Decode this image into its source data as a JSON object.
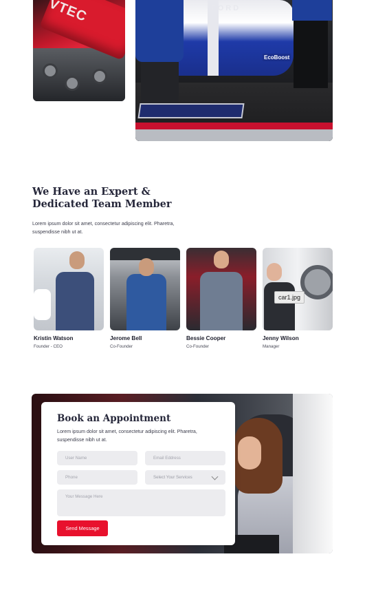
{
  "gallery": {
    "engine_text": "VTEC",
    "car_brand_text": "FORD",
    "car_sponsor_text": "EcoBoost"
  },
  "team": {
    "title": "We Have an Expert & Dedicated Team Member",
    "description": "Lorem ipsum dolor sit amet, consectetur adipiscing elit. Pharetra, suspendisse nibh ut at.",
    "members": [
      {
        "name": "Kristin Watson",
        "role": "Founder - CEO"
      },
      {
        "name": "Jerome Bell",
        "role": "Co-Founder"
      },
      {
        "name": "Bessie Cooper",
        "role": "Co-Founder"
      },
      {
        "name": "Jenny Wilson",
        "role": "Manager"
      }
    ],
    "tooltip": "car1.jpg"
  },
  "appointment": {
    "title": "Book an Appointment",
    "description": "Lorem ipsum dolor sit amet, consectetur adipiscing elit. Pharetra, suspendisse nibh ut at.",
    "fields": {
      "user_name_placeholder": "User Name",
      "email_placeholder": "Email Eddress",
      "phone_placeholder": "Phone",
      "services_placeholder": "Select Your Services",
      "message_placeholder": "Your Message Here"
    },
    "submit_label": "Send Message"
  },
  "colors": {
    "accent": "#e8112d",
    "heading": "#26273a",
    "field_bg": "#ececef"
  }
}
